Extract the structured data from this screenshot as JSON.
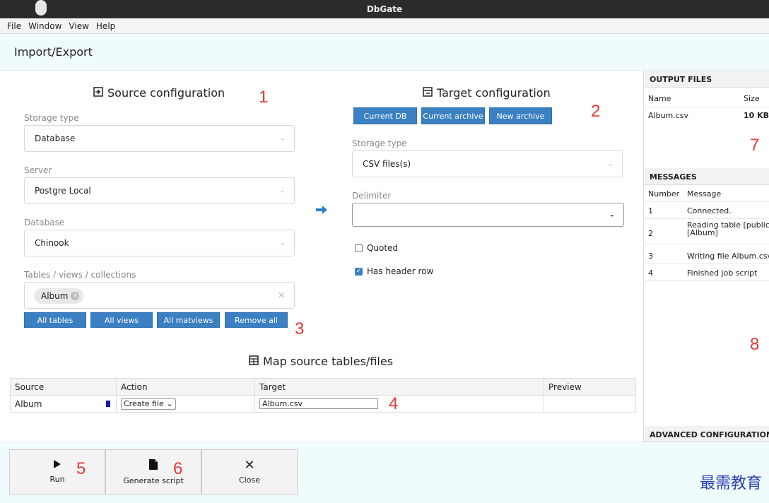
{
  "window": {
    "title": "DbGate"
  },
  "menu": [
    "File",
    "Window",
    "View",
    "Help"
  ],
  "header": {
    "title": "Import/Export"
  },
  "source": {
    "title": "Source configuration",
    "storage_type_label": "Storage type",
    "storage_type_value": "Database",
    "server_label": "Server",
    "server_value": "Postgre Local",
    "database_label": "Database",
    "database_value": "Chinook",
    "tables_label": "Tables / views / collections",
    "selected_table": "Album",
    "buttons": [
      "All tables",
      "All views",
      "All matviews",
      "Remove all"
    ]
  },
  "target": {
    "title": "Target configuration",
    "buttons": [
      "Current DB",
      "Current archive",
      "New archive"
    ],
    "storage_type_label": "Storage type",
    "storage_type_value": "CSV files(s)",
    "delimiter_label": "Delimiter",
    "delimiter_value": "",
    "quoted_label": "Quoted",
    "quoted_checked": false,
    "header_row_label": "Has header row",
    "header_row_checked": true
  },
  "map": {
    "title": "Map source tables/files",
    "columns": [
      "Source",
      "Action",
      "Target",
      "Preview"
    ],
    "rows": [
      {
        "source": "Album",
        "action": "Create file",
        "target": "Album.csv",
        "preview": ""
      }
    ]
  },
  "output_files": {
    "title": "OUTPUT FILES",
    "columns": [
      "Name",
      "Size"
    ],
    "rows": [
      {
        "name": "Album.csv",
        "size": "10 KB"
      }
    ]
  },
  "messages": {
    "title": "MESSAGES",
    "columns": [
      "Number",
      "Message"
    ],
    "rows": [
      {
        "number": "1",
        "message": "Connected."
      },
      {
        "number": "2",
        "message": "Reading table [public]",
        "message2": "[Album]"
      },
      {
        "number": "3",
        "message": "Writing file Album.csv"
      },
      {
        "number": "4",
        "message": "Finished job script"
      }
    ]
  },
  "advanced": {
    "title": "ADVANCED CONFIGURATION"
  },
  "footer": {
    "run_label": "Run",
    "generate_label": "Generate script",
    "close_label": "Close"
  },
  "annotations": [
    "1",
    "2",
    "3",
    "4",
    "5",
    "6",
    "7",
    "8"
  ],
  "watermark": "最需教育",
  "colors": {
    "accent": "#3a80c3",
    "annotation": "#e53935",
    "arrow": "#2f7fd1"
  }
}
